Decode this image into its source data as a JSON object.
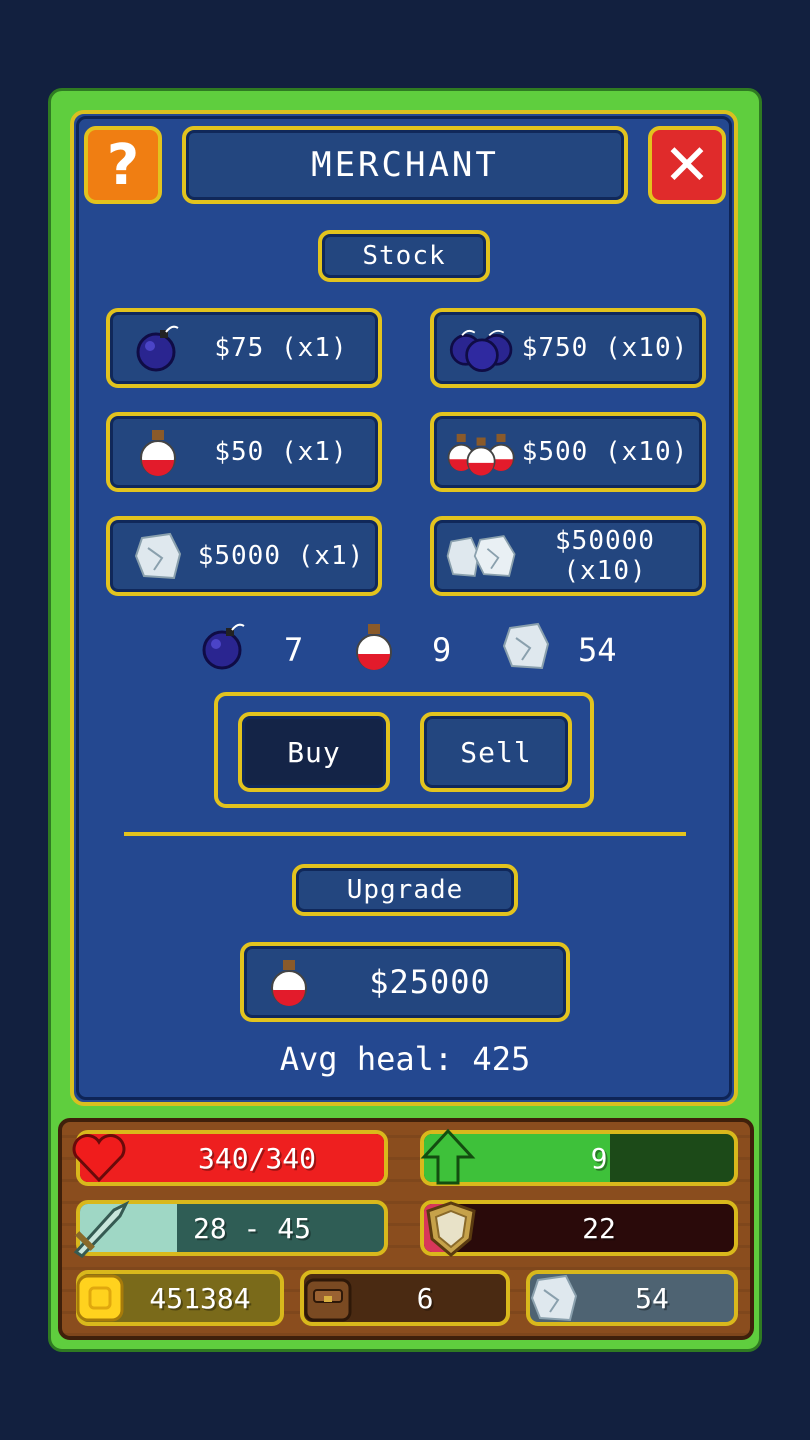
{
  "header": {
    "help_icon": "?",
    "title": "MERCHANT",
    "close_icon": "✕"
  },
  "stock": {
    "label": "Stock",
    "items": [
      {
        "icon": "bomb-icon",
        "label": "$75 (x1)"
      },
      {
        "icon": "bombs-icon",
        "label": "$750 (x10)"
      },
      {
        "icon": "potion-icon",
        "label": "$50 (x1)"
      },
      {
        "icon": "potions-icon",
        "label": "$500 (x10)"
      },
      {
        "icon": "crystal-icon",
        "label": "$5000 (x1)"
      },
      {
        "icon": "crystals-icon",
        "label": "$50000 (x10)"
      }
    ]
  },
  "inventory": {
    "bombs": "7",
    "potions": "9",
    "crystals": "54"
  },
  "mode": {
    "buy": "Buy",
    "sell": "Sell",
    "selected": "buy"
  },
  "upgrade": {
    "label": "Upgrade",
    "price": "$25000",
    "icon": "potion-icon",
    "avg_heal": "Avg heal: 425"
  },
  "hud": {
    "health": {
      "text": "340/340",
      "fill": 1.0,
      "color": "#ee1f1f"
    },
    "level": {
      "text": "9",
      "fill": 0.6,
      "color": "#3ec13a"
    },
    "attack": {
      "text": "28 - 45",
      "fill": 0.32,
      "color": "#9fd7c5"
    },
    "defense": {
      "text": "22",
      "fill": 0.08,
      "color": "#d8375a"
    },
    "gold": {
      "text": "451384"
    },
    "bag": {
      "text": "6"
    },
    "crystals": {
      "text": "54"
    }
  }
}
